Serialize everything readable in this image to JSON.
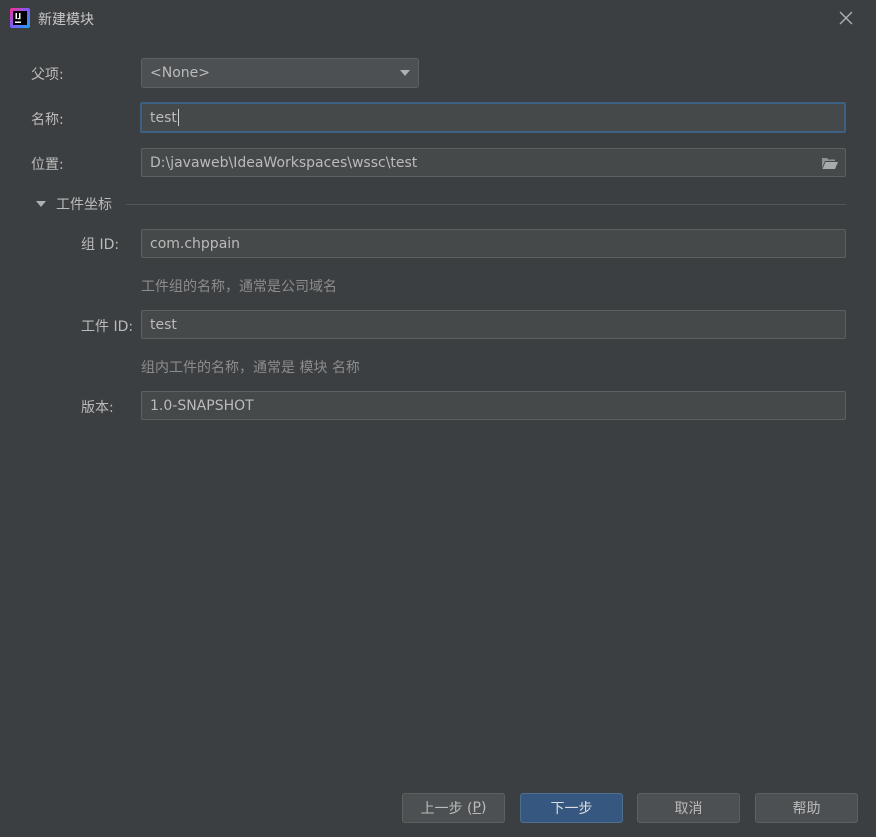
{
  "window": {
    "title": "新建模块"
  },
  "form": {
    "parent": {
      "label": "父项:",
      "value": "<None>"
    },
    "name": {
      "label": "名称:",
      "value": "test"
    },
    "location": {
      "label": "位置:",
      "value": "D:\\javaweb\\IdeaWorkspaces\\wssc\\test"
    }
  },
  "artifact_coords": {
    "section_title": "工件坐标",
    "group_id": {
      "label": "组 ID:",
      "value": "com.chppain",
      "hint": "工件组的名称，通常是公司域名"
    },
    "artifact_id": {
      "label": "工件 ID:",
      "value": "test",
      "hint": "组内工件的名称，通常是 模块 名称"
    },
    "version": {
      "label": "版本:",
      "value": "1.0-SNAPSHOT"
    }
  },
  "buttons": {
    "previous": {
      "label": "上一步 (",
      "mnemonic": "P",
      "suffix": ")"
    },
    "next": "下一步",
    "cancel": "取消",
    "help": "帮助"
  },
  "colors": {
    "background": "#3c3f41",
    "field_bg": "#45494a",
    "focus_border": "#3d6185",
    "primary_button": "#365880"
  }
}
